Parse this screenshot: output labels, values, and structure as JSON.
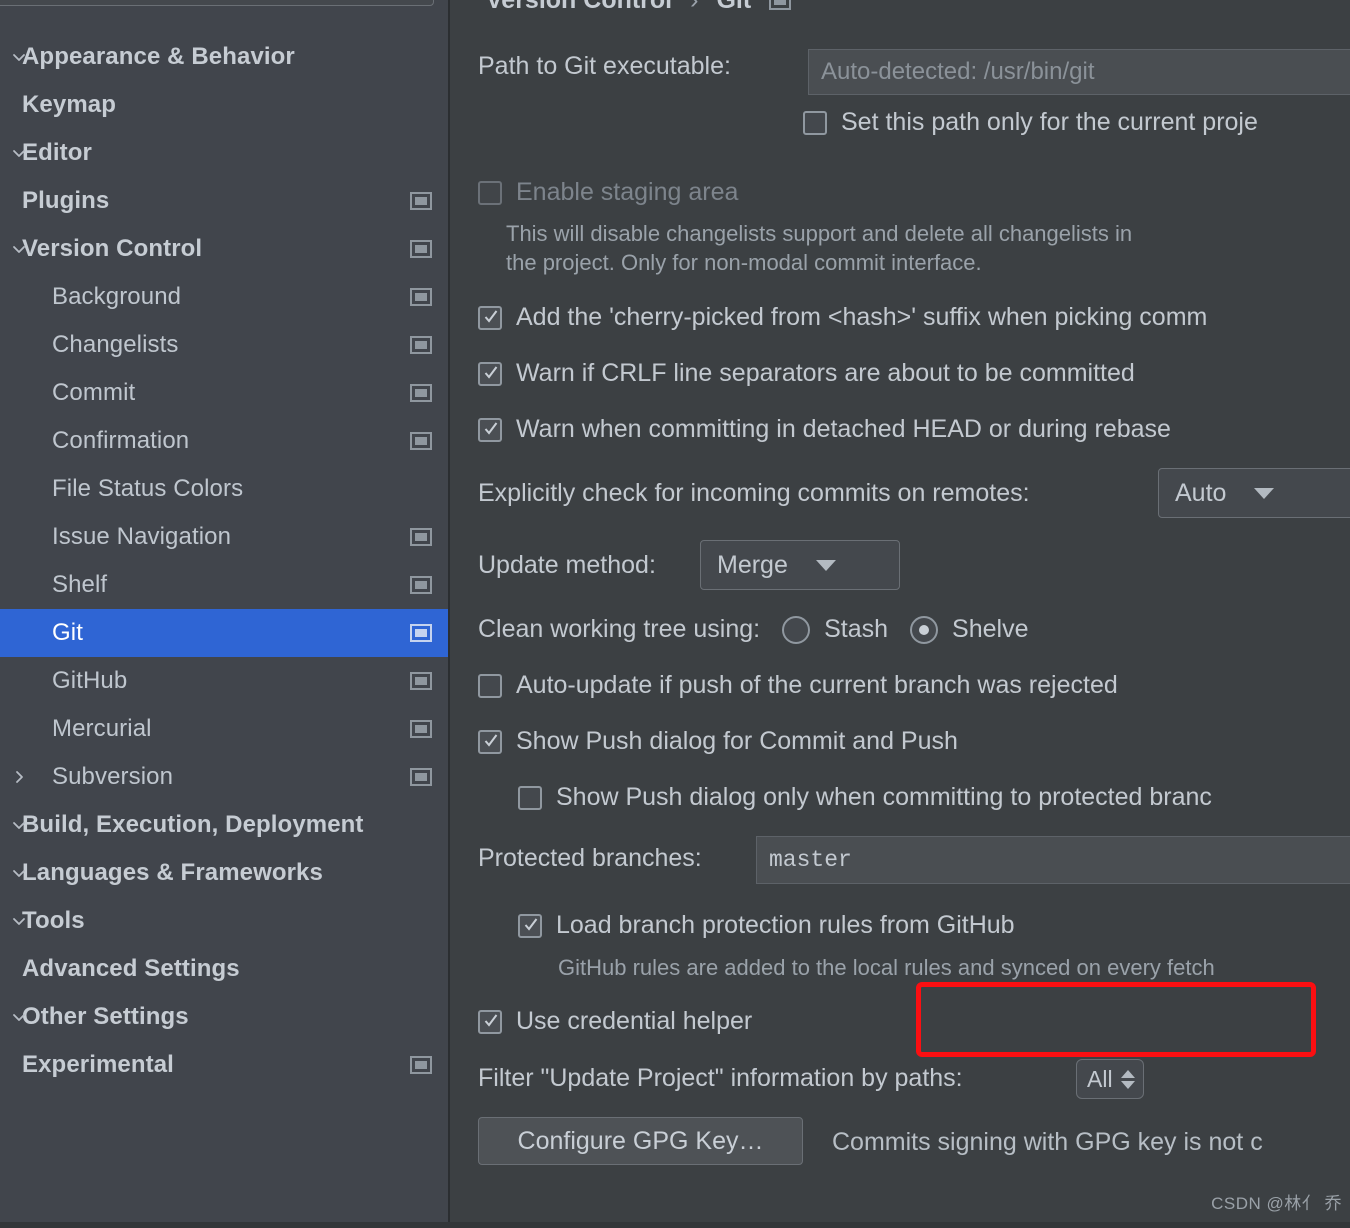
{
  "sidebar": {
    "search_placeholder": "",
    "items": [
      {
        "label": "Appearance & Behavior",
        "level": 0,
        "chevron": "down",
        "icon": false,
        "selected": false
      },
      {
        "label": "Keymap",
        "level": 0,
        "chevron": "none",
        "icon": false,
        "selected": false
      },
      {
        "label": "Editor",
        "level": 0,
        "chevron": "down",
        "icon": false,
        "selected": false
      },
      {
        "label": "Plugins",
        "level": 0,
        "chevron": "none",
        "icon": true,
        "selected": false
      },
      {
        "label": "Version Control",
        "level": 0,
        "chevron": "down",
        "icon": true,
        "selected": false
      },
      {
        "label": "Background",
        "level": 1,
        "chevron": "none",
        "icon": true,
        "selected": false
      },
      {
        "label": "Changelists",
        "level": 1,
        "chevron": "none",
        "icon": true,
        "selected": false
      },
      {
        "label": "Commit",
        "level": 1,
        "chevron": "none",
        "icon": true,
        "selected": false
      },
      {
        "label": "Confirmation",
        "level": 1,
        "chevron": "none",
        "icon": true,
        "selected": false
      },
      {
        "label": "File Status Colors",
        "level": 1,
        "chevron": "none",
        "icon": false,
        "selected": false
      },
      {
        "label": "Issue Navigation",
        "level": 1,
        "chevron": "none",
        "icon": true,
        "selected": false
      },
      {
        "label": "Shelf",
        "level": 1,
        "chevron": "none",
        "icon": true,
        "selected": false
      },
      {
        "label": "Git",
        "level": 1,
        "chevron": "none",
        "icon": true,
        "selected": true
      },
      {
        "label": "GitHub",
        "level": 1,
        "chevron": "none",
        "icon": true,
        "selected": false
      },
      {
        "label": "Mercurial",
        "level": 1,
        "chevron": "none",
        "icon": true,
        "selected": false
      },
      {
        "label": "Subversion",
        "level": 1,
        "chevron": "right",
        "icon": true,
        "selected": false
      },
      {
        "label": "Build, Execution, Deployment",
        "level": 0,
        "chevron": "down",
        "icon": false,
        "selected": false
      },
      {
        "label": "Languages & Frameworks",
        "level": 0,
        "chevron": "down",
        "icon": false,
        "selected": false
      },
      {
        "label": "Tools",
        "level": 0,
        "chevron": "down",
        "icon": false,
        "selected": false
      },
      {
        "label": "Advanced Settings",
        "level": 0,
        "chevron": "none",
        "icon": false,
        "selected": false
      },
      {
        "label": "Other Settings",
        "level": 0,
        "chevron": "down",
        "icon": false,
        "selected": false
      },
      {
        "label": "Experimental",
        "level": 0,
        "chevron": "none",
        "icon": true,
        "selected": false
      }
    ]
  },
  "breadcrumb": {
    "parent": "Version Control",
    "separator": "›",
    "current": "Git"
  },
  "git_settings": {
    "path_label": "Path to Git executable:",
    "path_placeholder": "Auto-detected: /usr/bin/git",
    "path_value": "",
    "set_path_only_current_project": {
      "label": "Set this path only for the current proje",
      "checked": false
    },
    "enable_staging_area": {
      "label": "Enable staging area",
      "checked": false,
      "disabled": true
    },
    "staging_hint_line1": "This will disable changelists support and delete all changelists in",
    "staging_hint_line2": "the project. Only for non-modal commit interface.",
    "cherry_picked": {
      "label": "Add the 'cherry-picked from <hash>' suffix when picking comm",
      "checked": true
    },
    "warn_crlf": {
      "label": "Warn if CRLF line separators are about to be committed",
      "checked": true
    },
    "warn_detached": {
      "label": "Warn when committing in detached HEAD or during rebase",
      "checked": true
    },
    "incoming_commits": {
      "label": "Explicitly check for incoming commits on remotes:",
      "value": "Auto"
    },
    "update_method": {
      "label": "Update method:",
      "value": "Merge"
    },
    "clean_working_tree": {
      "label": "Clean working tree using:",
      "options": [
        "Stash",
        "Shelve"
      ],
      "selected": "Shelve"
    },
    "auto_update_push_rejected": {
      "label": "Auto-update if push of the current branch was rejected",
      "checked": false
    },
    "show_push_dialog": {
      "label": "Show Push dialog for Commit and Push",
      "checked": true
    },
    "show_push_dialog_protected": {
      "label": "Show Push dialog only when committing to protected branc",
      "checked": false
    },
    "protected_branches": {
      "label": "Protected branches:",
      "value": "master"
    },
    "load_branch_protection": {
      "label": "Load branch protection rules from GitHub",
      "checked": true
    },
    "github_rules_hint": "GitHub rules are added to the local rules and synced on every fetch",
    "use_credential_helper": {
      "label": "Use credential helper",
      "checked": true,
      "highlighted": true
    },
    "filter_update_project": {
      "label": "Filter \"Update Project\" information by paths:",
      "value": "All"
    },
    "configure_gpg_key_button": "Configure GPG Key…",
    "gpg_status": "Commits signing with GPG key is not c"
  },
  "annotation": {
    "highlight_color": "#fb0f12"
  },
  "watermark": "CSDN @林亻 乔"
}
